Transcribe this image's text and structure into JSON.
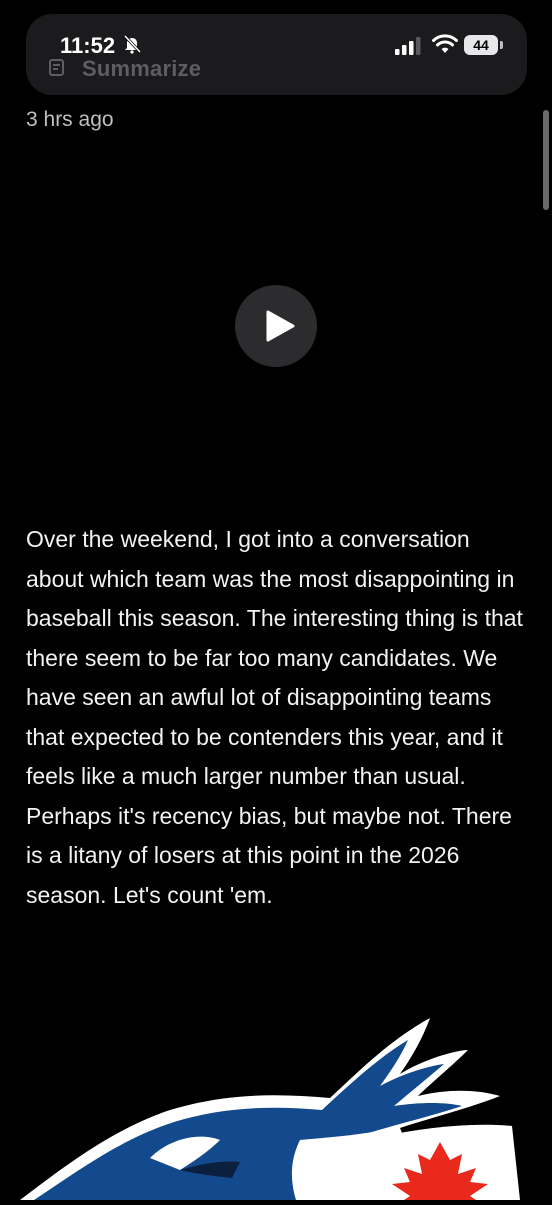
{
  "status_bar": {
    "time": "11:52",
    "battery": "44"
  },
  "toolbar": {
    "summarize_label": "Summarize"
  },
  "article": {
    "timestamp": "3 hrs ago",
    "body": "Over the weekend, I got into a conversation about which team was the most disappointing in baseball this season. The interesting thing is that there seem to be far too many candidates. We have seen an awful lot of disappointing teams that expected to be contenders this year, and it feels like a much larger number than usual. Perhaps it's recency bias, but maybe not. There is a litany of losers at this point in the 2026 season. Let's count 'em."
  },
  "icons": {
    "summarize": "summarize-icon",
    "bell_muted": "bell-slash-icon",
    "signal": "cellular-signal-icon",
    "wifi": "wifi-icon",
    "battery": "battery-icon",
    "play": "play-icon",
    "logo": "blue-jays-logo"
  },
  "colors": {
    "background": "#000000",
    "bar_background": "#1b1b1d",
    "muted_text": "#bfbfc4",
    "play_button": "#2c2c2e",
    "logo_blue": "#134a8e",
    "logo_red": "#e8291c"
  }
}
